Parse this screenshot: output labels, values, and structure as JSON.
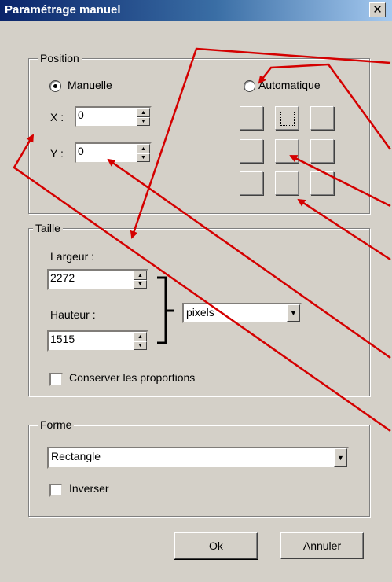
{
  "window": {
    "title": "Paramétrage manuel",
    "close_glyph": "✕"
  },
  "position": {
    "legend": "Position",
    "manual_label": "Manuelle",
    "auto_label": "Automatique",
    "manual_selected": true,
    "x_label": "X :",
    "y_label": "Y :",
    "x_value": "0",
    "y_value": "0"
  },
  "taille": {
    "legend": "Taille",
    "width_label": "Largeur :",
    "width_value": "2272",
    "height_label": "Hauteur :",
    "height_value": "1515",
    "unit_value": "pixels",
    "keep_ratio_label": "Conserver les proportions",
    "keep_ratio_checked": false
  },
  "forme": {
    "legend": "Forme",
    "shape_value": "Rectangle",
    "invert_label": "Inverser",
    "invert_checked": false
  },
  "buttons": {
    "ok": "Ok",
    "cancel": "Annuler"
  },
  "annotation_color": "#d40000",
  "icons": {
    "spin_up": "▲",
    "spin_down": "▼",
    "dropdown": "▼"
  }
}
